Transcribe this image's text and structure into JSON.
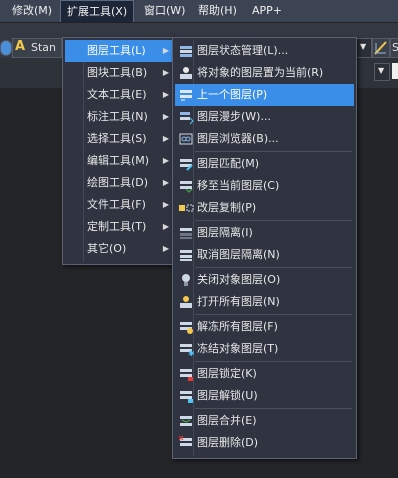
{
  "menubar": {
    "items": [
      "修改(M)",
      "扩展工具(X)",
      "窗口(W)",
      "帮助(H)",
      "APP+"
    ]
  },
  "toolbar": {
    "style_text": "Stan",
    "right_text": "S"
  },
  "main_menu": {
    "items": [
      {
        "label": "图层工具(L)",
        "highlighted": true
      },
      {
        "label": "图块工具(B)"
      },
      {
        "label": "文本工具(E)"
      },
      {
        "label": "标注工具(N)"
      },
      {
        "label": "选择工具(S)"
      },
      {
        "label": "编辑工具(M)"
      },
      {
        "label": "绘图工具(D)"
      },
      {
        "label": "文件工具(F)"
      },
      {
        "label": "定制工具(T)"
      },
      {
        "label": "其它(O)"
      }
    ]
  },
  "submenu": {
    "items": [
      {
        "label": "图层状态管理(L)...",
        "icon": "layer-state-icon"
      },
      {
        "label": "将对象的图层置为当前(R)",
        "icon": "make-current-icon"
      },
      {
        "label": "上一个图层(P)",
        "icon": "layer-previous-icon",
        "highlighted": true
      },
      {
        "label": "图层漫步(W)...",
        "icon": "layer-walk-icon"
      },
      {
        "label": "图层浏览器(B)...",
        "icon": "layer-browser-icon"
      },
      {
        "label": "图层匹配(M)",
        "icon": "layer-match-icon"
      },
      {
        "label": "移至当前图层(C)",
        "icon": "move-to-current-icon"
      },
      {
        "label": "改层复制(P)",
        "icon": "copy-to-layer-icon"
      },
      {
        "label": "图层隔离(I)",
        "icon": "layer-isolate-icon"
      },
      {
        "label": "取消图层隔离(N)",
        "icon": "layer-unisolate-icon"
      },
      {
        "label": "关闭对象图层(O)",
        "icon": "layer-off-icon"
      },
      {
        "label": "打开所有图层(N)",
        "icon": "layer-on-icon"
      },
      {
        "label": "解冻所有图层(F)",
        "icon": "layer-thaw-icon"
      },
      {
        "label": "冻结对象图层(T)",
        "icon": "layer-freeze-icon"
      },
      {
        "label": "图层锁定(K)",
        "icon": "layer-lock-icon"
      },
      {
        "label": "图层解锁(U)",
        "icon": "layer-unlock-icon"
      },
      {
        "label": "图层合并(E)",
        "icon": "layer-merge-icon"
      },
      {
        "label": "图层删除(D)",
        "icon": "layer-delete-icon"
      }
    ]
  },
  "colors": {
    "highlight": "#3b8ee8",
    "menu_bg": "#2f3440",
    "menubar_bg": "#3c4453"
  }
}
